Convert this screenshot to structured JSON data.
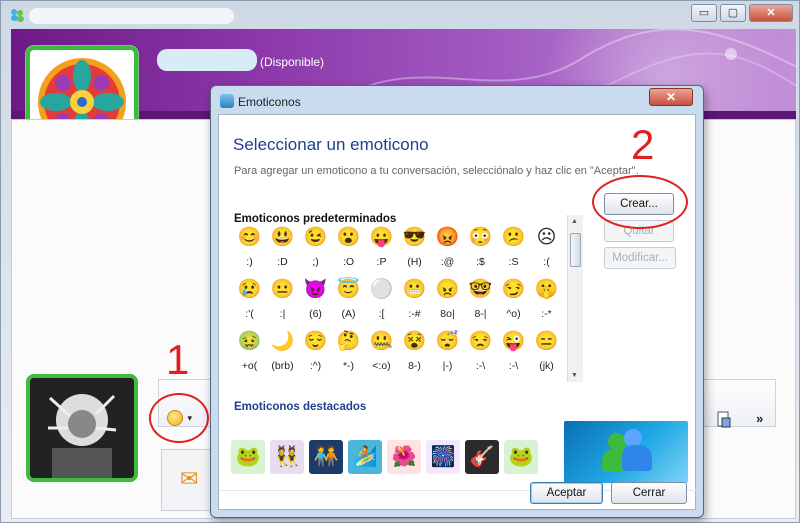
{
  "window": {
    "controls": {
      "minimize": "▭",
      "maximize": "▢",
      "close": "✕"
    }
  },
  "header": {
    "status": "(Disponible)"
  },
  "dialog": {
    "title": "Emoticonos",
    "close": "✕",
    "heading": "Seleccionar un emoticono",
    "subtitle": "Para agregar un emoticono a tu conversación, selecciónalo y haz clic en \"Aceptar\".",
    "default_section": "Emoticonos predeterminados",
    "emoticons": [
      {
        "icon": "😊",
        "code": ":)"
      },
      {
        "icon": "😃",
        "code": ":D"
      },
      {
        "icon": "😉",
        "code": ";)"
      },
      {
        "icon": "😮",
        "code": ":O"
      },
      {
        "icon": "😛",
        "code": ":P"
      },
      {
        "icon": "😎",
        "code": "(H)"
      },
      {
        "icon": "😡",
        "code": ":@"
      },
      {
        "icon": "😳",
        "code": ":$"
      },
      {
        "icon": "😕",
        "code": ":S"
      },
      {
        "icon": "☹",
        "code": ":("
      },
      {
        "icon": "😢",
        "code": ":'("
      },
      {
        "icon": "😐",
        "code": ":|"
      },
      {
        "icon": "😈",
        "code": "(6)"
      },
      {
        "icon": "😇",
        "code": "(A)"
      },
      {
        "icon": "⚪",
        "code": ":["
      },
      {
        "icon": "😬",
        "code": ":-#"
      },
      {
        "icon": "😠",
        "code": "8o|"
      },
      {
        "icon": "🤓",
        "code": "8-|"
      },
      {
        "icon": "😏",
        "code": "^o)"
      },
      {
        "icon": "🤫",
        "code": ":-*"
      },
      {
        "icon": "🤢",
        "code": "+o("
      },
      {
        "icon": "🌙",
        "code": "(brb)"
      },
      {
        "icon": "😌",
        "code": ":^)"
      },
      {
        "icon": "🤔",
        "code": "*-)"
      },
      {
        "icon": "🤐",
        "code": "<:o)"
      },
      {
        "icon": "😵",
        "code": "8-)"
      },
      {
        "icon": "😴",
        "code": "|-)"
      },
      {
        "icon": "😒",
        "code": ":-\\"
      },
      {
        "icon": "😜",
        "code": ":-\\"
      },
      {
        "icon": "😑",
        "code": "(jk)"
      }
    ],
    "buttons": {
      "create": "Crear...",
      "remove": "Quitar",
      "modify": "Modificar...",
      "ok": "Aceptar",
      "cancel": "Cerrar"
    },
    "featured_section": "Emoticonos destacados",
    "featured": [
      "🐸",
      "👯",
      "🧑‍🤝‍🧑",
      "🏄",
      "🌺",
      "🎆",
      "🎸",
      "🐸"
    ]
  },
  "annotations": {
    "label1": "1",
    "label2": "2"
  },
  "toolbar": {
    "emoticon_button": "☺",
    "dropdown": "▾",
    "more": "»",
    "mail_icon": "✉"
  },
  "colors": {
    "accent": "#1f3f8f",
    "annotation": "#e02020",
    "avatar_border": "#3dbb3d",
    "banner": "#8b36a8"
  }
}
